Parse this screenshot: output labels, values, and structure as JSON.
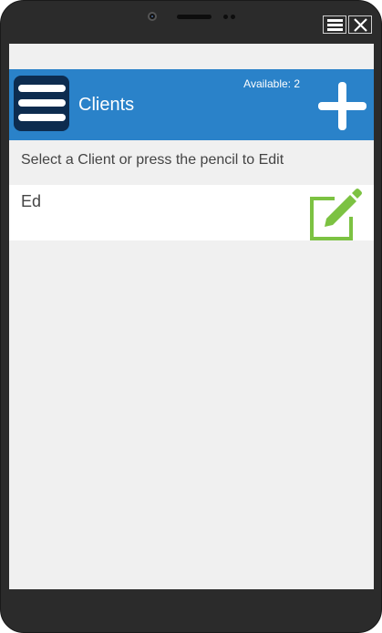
{
  "app": {
    "title": "Clients",
    "available": "Available: 2",
    "instructions": "Select a Client or press the pencil to Edit"
  },
  "clients": [
    {
      "name": "Ed"
    }
  ],
  "colors": {
    "header": "#2a82c9",
    "menu_tile": "#0d2c4f",
    "edit_icon": "#7cc242",
    "screen_bg": "#f0f0f0",
    "device_bezel": "#2b2b2b"
  },
  "icons": {
    "menu": "hamburger-icon",
    "add": "plus-icon",
    "edit": "pencil-edit-icon",
    "window_menu": "window-menu-icon",
    "window_close": "close-icon"
  }
}
